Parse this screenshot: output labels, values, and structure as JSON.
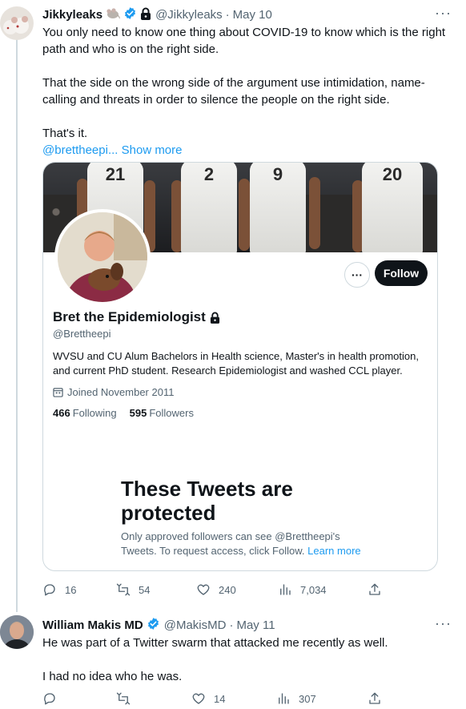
{
  "tweet1": {
    "name": "Jikkyleaks",
    "handle": "@Jikkyleaks",
    "date": "May 10",
    "text": {
      "p1": "You only need to know one thing about COVID-19 to know which is the right path and who is on the right side.",
      "p2": "That the side on the wrong side of the argument use intimidation, name-calling and threats in order to silence the people on the right side.",
      "p3": "That's it.",
      "mention": "@brettheepi...",
      "show_more": "Show more"
    },
    "actions": {
      "replies": "16",
      "retweets": "54",
      "likes": "240",
      "views": "7,034"
    }
  },
  "card": {
    "banner_numbers": [
      "21",
      "2",
      "9",
      "20"
    ],
    "more_label": "···",
    "follow_label": "Follow",
    "name": "Bret the Epidemiologist",
    "handle": "@Brettheepi",
    "bio": "WVSU and CU Alum Bachelors in Health science, Master's in health promotion, and current PhD student. Research Epidemiologist and washed CCL player.",
    "joined": "Joined November 2011",
    "following_count": "466",
    "following_label": "Following",
    "followers_count": "595",
    "followers_label": "Followers",
    "protected_title": "These Tweets are protected",
    "protected_text": "Only approved followers can see @Brettheepi's Tweets. To request access, click Follow.",
    "learn_more": "Learn more"
  },
  "tweet2": {
    "name": "William Makis MD",
    "handle": "@MakisMD",
    "date": "May 11",
    "text": {
      "p1": "He was part of a Twitter swarm that attacked me recently as well.",
      "p2": "I had no idea who he was."
    },
    "actions": {
      "replies": "",
      "retweets": "",
      "likes": "14",
      "views": "307"
    }
  },
  "separator": "·",
  "more_icon": "···",
  "colors": {
    "accent": "#1d9bf0",
    "text": "#0f1419",
    "secondary": "#536471",
    "border": "#cfd9de"
  },
  "icons": [
    "verified-badge-icon",
    "lock-icon",
    "rat-emoji-icon",
    "calendar-icon",
    "reply-icon",
    "retweet-icon",
    "like-icon",
    "views-icon",
    "share-icon",
    "more-icon"
  ]
}
